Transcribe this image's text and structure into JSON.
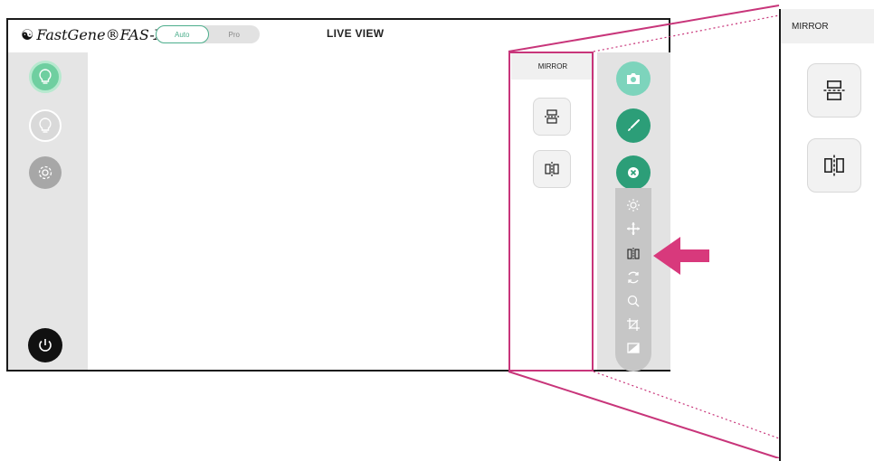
{
  "brand": {
    "logo_text": "FastGene®FAS-X"
  },
  "mode_toggle": {
    "options": [
      "Auto",
      "Pro"
    ],
    "selected": "Auto"
  },
  "live_view": {
    "title": "LIVE VIEW"
  },
  "left_sidebar": {
    "buttons": [
      "lightbulb-on",
      "lightbulb-off",
      "settings",
      "power"
    ]
  },
  "mirror_panel": {
    "header": "MIRROR",
    "buttons": [
      "flip-vertical-icon",
      "flip-horizontal-icon"
    ]
  },
  "right_tools": {
    "circles": [
      "camera-icon",
      "brush-icon",
      "close-icon"
    ],
    "strip": [
      "brightness-icon",
      "move-icon",
      "mirror-icon",
      "rotate-icon",
      "zoom-icon",
      "crop-icon",
      "contrast-icon"
    ]
  },
  "zoom_callout": {
    "header": "MIRROR"
  },
  "colors": {
    "accent_green": "#2c9e78",
    "light_green": "#6fcfa0",
    "highlight_pink": "#c8357a"
  }
}
